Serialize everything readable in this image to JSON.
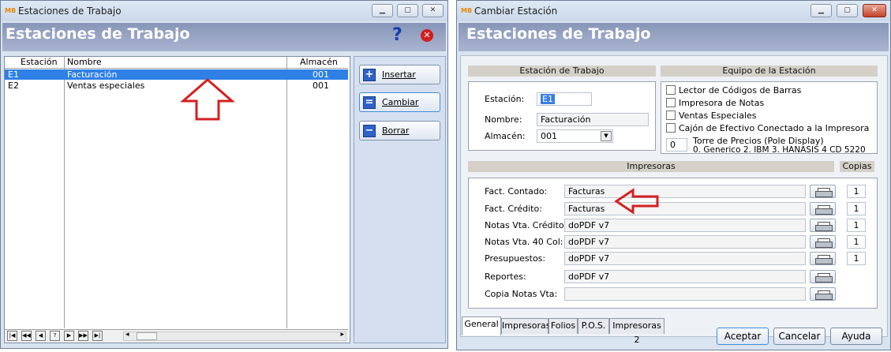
{
  "left_window": {
    "title": "Estaciones de Trabajo",
    "header": "Estaciones de Trabajo",
    "help_glyph": "?",
    "columns": [
      "Estación",
      "Nombre",
      "Almacén"
    ],
    "rows": [
      {
        "estacion": "E1",
        "nombre": "Facturación",
        "almacen": "001",
        "selected": true
      },
      {
        "estacion": "E2",
        "nombre": "Ventas especiales",
        "almacen": "001",
        "selected": false
      }
    ],
    "buttons": {
      "insertar": "Insertar",
      "cambiar": "Cambiar",
      "borrar": "Borrar"
    },
    "navigator": [
      "|◀",
      "◀◀",
      "◀",
      "?",
      "▶",
      "▶▶",
      "▶|"
    ]
  },
  "right_window": {
    "title": "Cambiar Estación",
    "header": "Estaciones de Trabajo",
    "workstation_section": "Estación de Trabajo",
    "equipment_section": "Equipo de la Estación",
    "fields": {
      "estacion_label": "Estación:",
      "estacion_value": "E1",
      "nombre_label": "Nombre:",
      "nombre_value": "Facturación",
      "almacen_label": "Almacén:",
      "almacen_value": "001"
    },
    "equipment": [
      "Lector de Códigos de Barras",
      "Impresora de Notas",
      "Ventas Especiales",
      "Cajón de Efectivo Conectado a la Impresora"
    ],
    "pole_display": {
      "value": "0",
      "label": "Torre de Precios (Pole Display)",
      "options": "0. Generico 2. IBM 3. HANASIS 4 CD 5220"
    },
    "printers_section": "Impresoras",
    "copies_section": "Copias",
    "printers": [
      {
        "label": "Fact. Contado:",
        "value": "Facturas",
        "copies": "1"
      },
      {
        "label": "Fact. Crédito:",
        "value": "Facturas",
        "copies": "1"
      },
      {
        "label": "Notas Vta. Crédito:",
        "value": "doPDF v7",
        "copies": "1"
      },
      {
        "label": "Notas Vta. 40 Col:",
        "value": "doPDF v7",
        "copies": "1"
      },
      {
        "label": "Presupuestos:",
        "value": "doPDF v7",
        "copies": "1"
      },
      {
        "label": "Reportes:",
        "value": "doPDF v7",
        "copies": ""
      },
      {
        "label": "Copia Notas Vta:",
        "value": "",
        "copies": ""
      }
    ],
    "tabs": [
      "General",
      "Impresoras",
      "Folios",
      "P.O.S.",
      "Impresoras 2"
    ],
    "buttons": {
      "aceptar": "Aceptar",
      "cancelar": "Cancelar",
      "ayuda": "Ayuda"
    }
  },
  "colors": {
    "selection": "#2f80e5",
    "header": "#8796b8",
    "arrow": "#d42020"
  }
}
